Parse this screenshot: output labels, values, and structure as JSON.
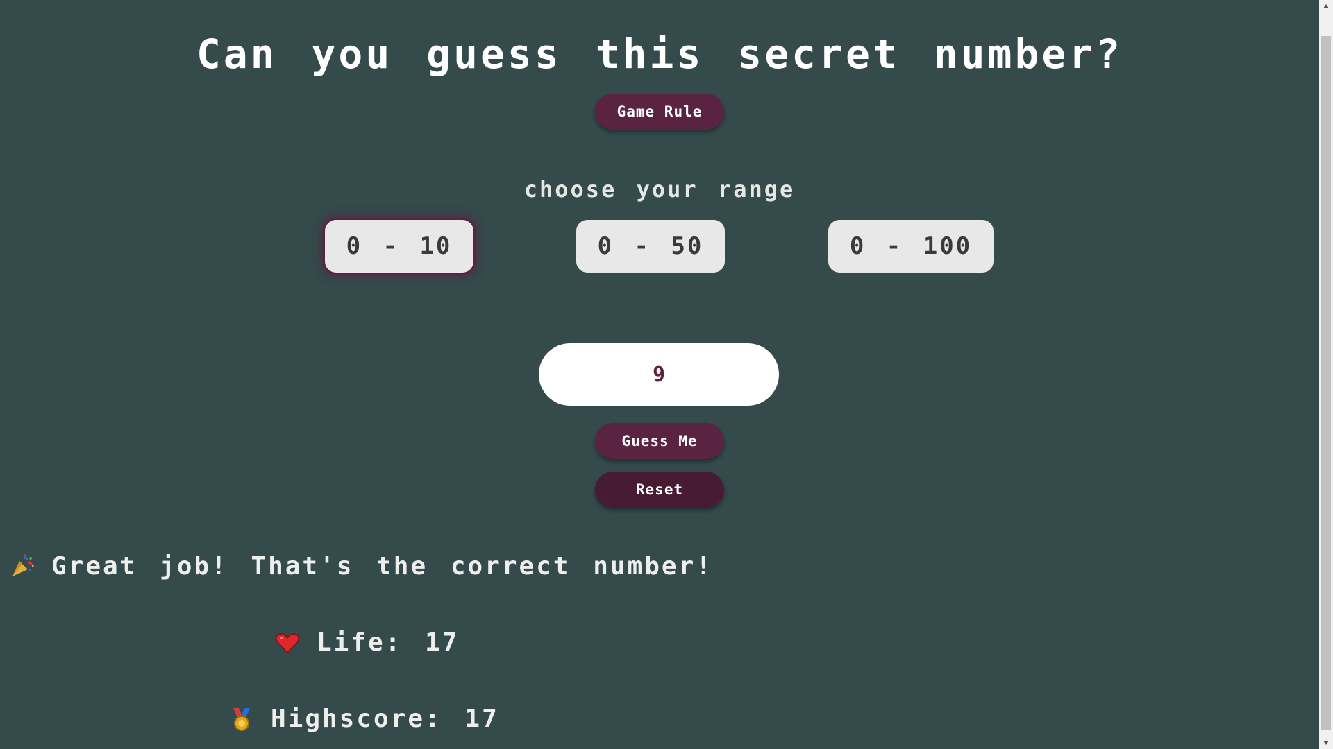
{
  "title": "Can you guess this secret number?",
  "buttons": {
    "game_rule": "Game Rule",
    "guess": "Guess Me",
    "reset": "Reset"
  },
  "range": {
    "heading": "choose your range",
    "options": [
      "0 - 10",
      "0 - 50",
      "0 - 100"
    ],
    "selected": "0 - 10"
  },
  "guess_input": {
    "value": "9"
  },
  "message": {
    "text": "Great job! That's the correct number!",
    "icon": "party-popper-icon"
  },
  "stats": {
    "life": "Life: 17",
    "highscore": "Highscore: 17",
    "life_icon": "heart-icon",
    "highscore_icon": "medal-icon"
  },
  "colors": {
    "background": "#344a4b",
    "button": "#5a2342",
    "button_dark": "#461b33",
    "range_button": "#e8e8e8",
    "text": "#ffffff"
  }
}
